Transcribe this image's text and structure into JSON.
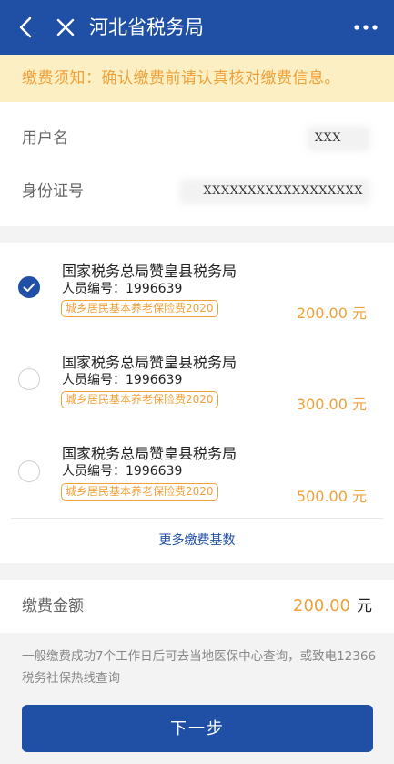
{
  "header": {
    "title": "河北省税务局",
    "back_icon": "chevron-left-icon",
    "close_icon": "close-icon",
    "more_icon": "more-horizontal-icon"
  },
  "notice": {
    "text": "缴费须知：确认缴费前请认真核对缴费信息。"
  },
  "info": {
    "username_label": "用户名",
    "username_value": "XXX",
    "id_label": "身份证号",
    "id_value": "XXXXXXXXXXXXXXXXXX"
  },
  "items": [
    {
      "org": "国家税务总局赞皇县税务局",
      "person_id": "人员编号：1996639",
      "tag": "城乡居民基本养老保险费2020",
      "amount": "200.00 元",
      "checked": true
    },
    {
      "org": "国家税务总局赞皇县税务局",
      "person_id": "人员编号：1996639",
      "tag": "城乡居民基本养老保险费2020",
      "amount": "300.00 元",
      "checked": false
    },
    {
      "org": "国家税务总局赞皇县税务局",
      "person_id": "人员编号：1996639",
      "tag": "城乡居民基本养老保险费2020",
      "amount": "500.00 元",
      "checked": false
    }
  ],
  "more_link": "更多缴费基数",
  "total": {
    "label": "缴费金额",
    "amount": "200.00",
    "unit": "元"
  },
  "note": "一般缴费成功7个工作日后可去当地医保中心查询，或致电12366税务社保热线查询",
  "next_button": "下一步",
  "colors": {
    "primary": "#2050a6",
    "accent": "#f0a13a",
    "notice_bg": "#fcefc4"
  }
}
